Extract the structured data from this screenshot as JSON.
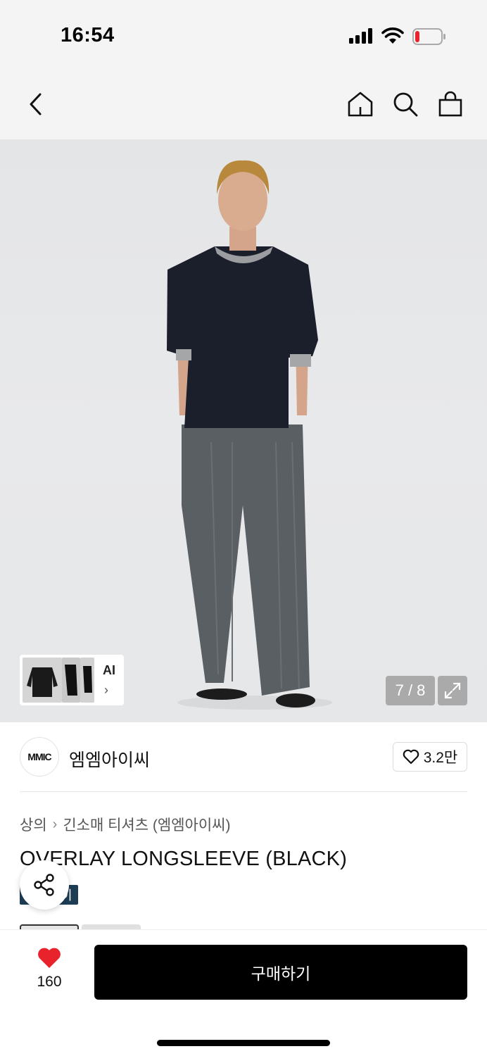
{
  "status_bar": {
    "time": "16:54"
  },
  "image": {
    "page_counter": "7 / 8",
    "ai_label": "AI"
  },
  "brand": {
    "logo_text": "MMIC",
    "name": "엠엠아이씨",
    "likes": "3.2만"
  },
  "breadcrumb": {
    "category": "상의",
    "subcategory": "긴소매 티셔츠 (엠엠아이씨)"
  },
  "product": {
    "title": "OVERLAY LONGSLEEVE (BLACK)",
    "tag": "이"
  },
  "bottom": {
    "heart_count": "160",
    "buy_label": "구매하기"
  },
  "colors": {
    "badge": "#1d3d55",
    "heart": "#e8232b",
    "buy": "#000000"
  }
}
